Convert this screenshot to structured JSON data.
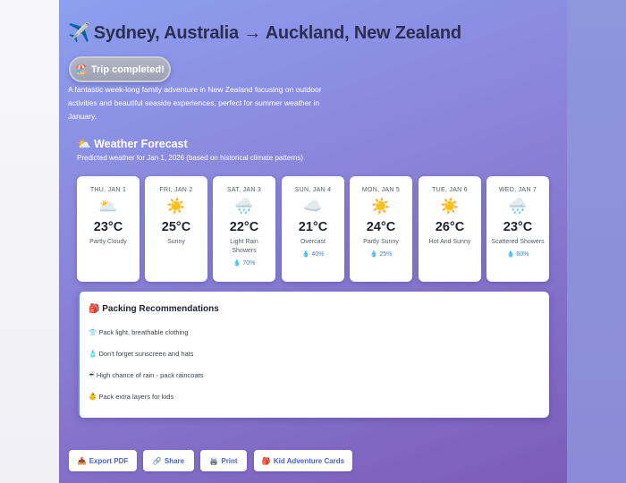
{
  "trip": {
    "title": "Sydney, Australia → Auckland, New Zealand",
    "title_icon": "✈️",
    "status_icon": "🏖️",
    "status": "Trip completed!",
    "description": "A fantastic week-long family adventure in New Zealand focusing on outdoor activities and beautiful seaside experiences, perfect for summer weather in January."
  },
  "forecast": {
    "icon": "⛅",
    "title": "Weather Forecast",
    "subtitle": "Predicted weather for Jan 1, 2026 (based on historical climate patterns)",
    "days": [
      {
        "label": "THU, JAN 1",
        "icon": "🌥️",
        "temp": "23°C",
        "condition": "Partly Cloudy",
        "rain": ""
      },
      {
        "label": "FRI, JAN 2",
        "icon": "☀️",
        "temp": "25°C",
        "condition": "Sunny",
        "rain": ""
      },
      {
        "label": "SAT, JAN 3",
        "icon": "🌧️",
        "temp": "22°C",
        "condition": "Light Rain Showers",
        "rain": "💧 70%"
      },
      {
        "label": "SUN, JAN 4",
        "icon": "☁️",
        "temp": "21°C",
        "condition": "Overcast",
        "rain": "💧 40%"
      },
      {
        "label": "MON, JAN 5",
        "icon": "☀️",
        "temp": "24°C",
        "condition": "Partly Sunny",
        "rain": "💧 25%"
      },
      {
        "label": "TUE, JAN 6",
        "icon": "☀️",
        "temp": "26°C",
        "condition": "Hot And Sunny",
        "rain": ""
      },
      {
        "label": "WED, JAN 7",
        "icon": "🌧️",
        "temp": "23°C",
        "condition": "Scattered Showers",
        "rain": "💧 60%"
      }
    ]
  },
  "packing": {
    "icon": "🎒",
    "title": "Packing Recommendations",
    "items": [
      {
        "icon": "👕",
        "text": "Pack light, breathable clothing"
      },
      {
        "icon": "🧴",
        "text": "Don't forget sunscreen and hats"
      },
      {
        "icon": "☔",
        "text": "High chance of rain - pack raincoats"
      },
      {
        "icon": "👶",
        "text": "Pack extra layers for kids"
      }
    ]
  },
  "actions": [
    {
      "icon": "📥",
      "label": "Export PDF"
    },
    {
      "icon": "🔗",
      "label": "Share"
    },
    {
      "icon": "🖨️",
      "label": "Print"
    },
    {
      "icon": "🎒",
      "label": "Kid Adventure Cards"
    }
  ]
}
